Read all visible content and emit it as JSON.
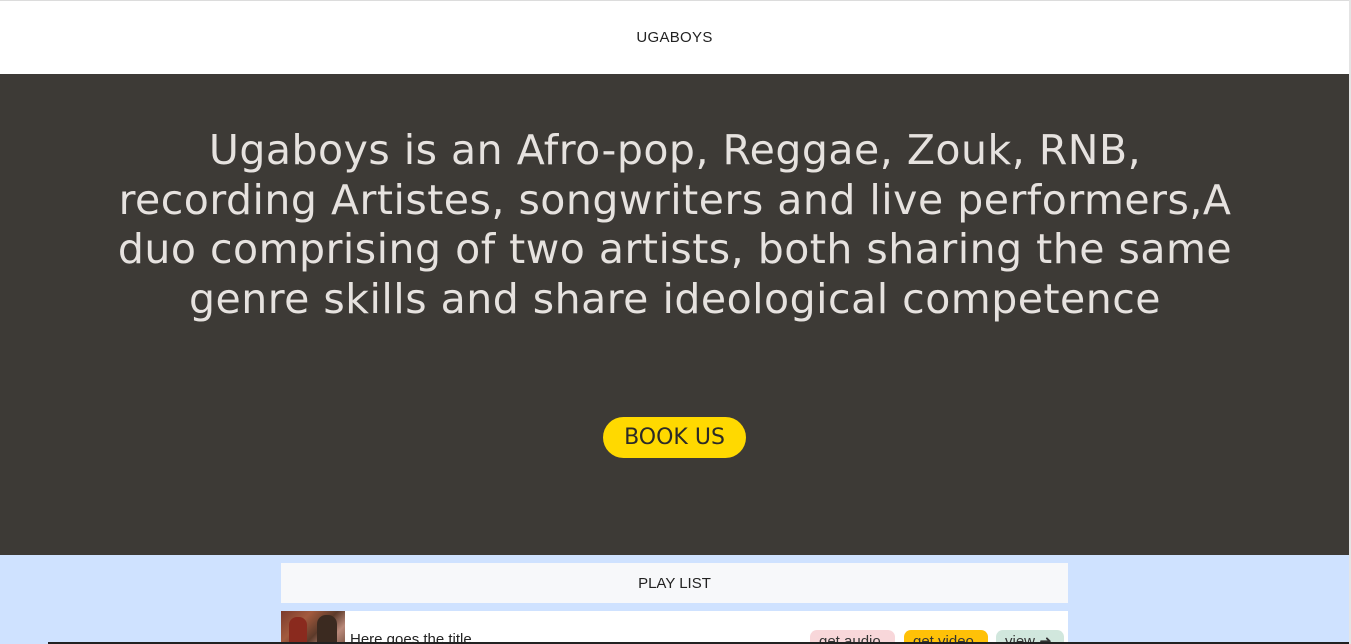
{
  "header": {
    "brand": "UGABOYS"
  },
  "hero": {
    "text": "Ugaboys is an Afro-pop, Reggae, Zouk, RNB, recording Artistes, songwriters and live performers,A duo comprising of two artists, both sharing the same genre skills and share ideological competence",
    "cta_label": "BOOK US"
  },
  "playlist": {
    "header": "PLAY LIST",
    "tracks": [
      {
        "title": "Here goes the title",
        "audio_label": "get audio",
        "video_label": "get video",
        "view_label": "view",
        "view_icon": "arrow-right-icon"
      }
    ]
  },
  "colors": {
    "hero_bg": "#3d3a36",
    "hero_text": "#e6e2df",
    "cta_bg": "#ffd900",
    "playlist_bg": "#cfe2ff",
    "audio_pill": "#f8d7da",
    "video_pill": "#ffc107",
    "view_pill": "#d1e7dd"
  }
}
